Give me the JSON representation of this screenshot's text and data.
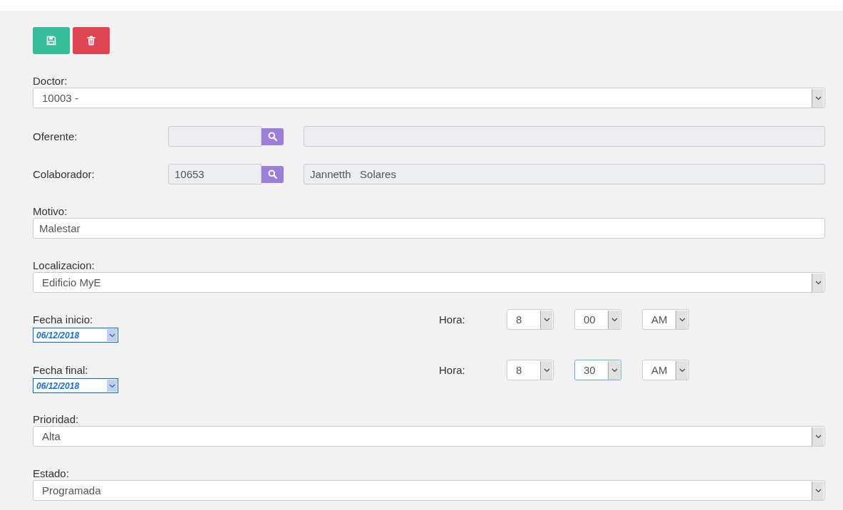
{
  "toolbar": {
    "buttons": [
      {
        "kind": "save"
      },
      {
        "kind": "delete"
      }
    ]
  },
  "doctor": {
    "label": "Doctor:",
    "value": "10003 -"
  },
  "oferente": {
    "label": "Oferente:"
  },
  "colaborador": {
    "label": "Colaborador:",
    "code": "10653",
    "name": "Jannetth   Solares"
  },
  "motivo": {
    "label": "Motivo:",
    "value": "Malestar"
  },
  "localizacion": {
    "label": "Localizacion:",
    "value": "Edificio MyE"
  },
  "schedule": [
    {
      "label": "Fecha inicio:",
      "date": "06/12/2018",
      "hora_label": "Hora:",
      "time": [
        {
          "value": "8",
          "focused": false
        },
        {
          "value": "00",
          "focused": false
        },
        {
          "value": "AM",
          "focused": false
        }
      ]
    },
    {
      "label": "Fecha final:",
      "date": "06/12/2018",
      "hora_label": "Hora:",
      "time": [
        {
          "value": "8",
          "focused": false
        },
        {
          "value": "30",
          "focused": true
        },
        {
          "value": "AM",
          "focused": false
        }
      ]
    }
  ],
  "prioridad": {
    "label": "Prioridad:",
    "value": "Alta"
  },
  "estado": {
    "label": "Estado:",
    "value": "Programada"
  }
}
